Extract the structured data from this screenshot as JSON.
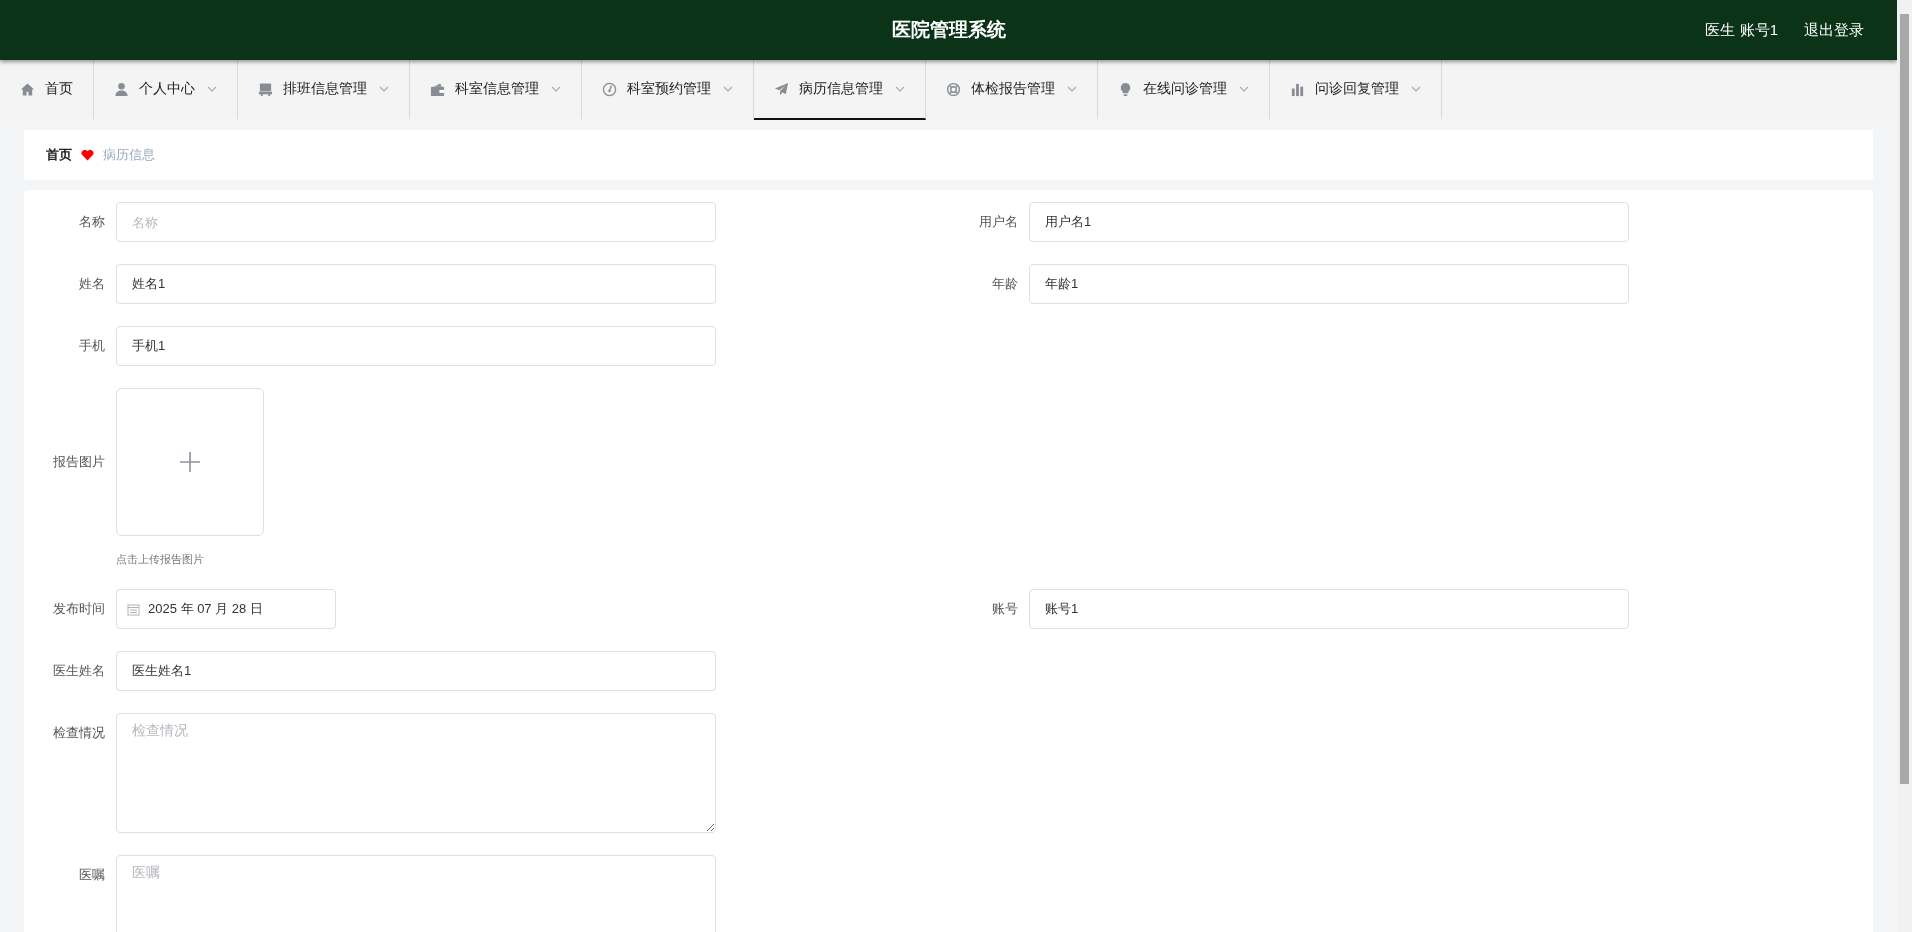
{
  "header": {
    "title": "医院管理系统",
    "user": "医生 账号1",
    "logout": "退出登录"
  },
  "nav": [
    {
      "label": "首页",
      "dropdown": false,
      "selected": false
    },
    {
      "label": "个人中心",
      "dropdown": true,
      "selected": false
    },
    {
      "label": "排班信息管理",
      "dropdown": true,
      "selected": false
    },
    {
      "label": "科室信息管理",
      "dropdown": true,
      "selected": false
    },
    {
      "label": "科室预约管理",
      "dropdown": true,
      "selected": false
    },
    {
      "label": "病历信息管理",
      "dropdown": true,
      "selected": true
    },
    {
      "label": "体检报告管理",
      "dropdown": true,
      "selected": false
    },
    {
      "label": "在线问诊管理",
      "dropdown": true,
      "selected": false
    },
    {
      "label": "问诊回复管理",
      "dropdown": true,
      "selected": false
    }
  ],
  "breadcrumb": [
    "首页",
    "病历信息"
  ],
  "form": [
    {
      "fields": [
        {
          "kind": "input",
          "label": "名称",
          "placeholder": "名称"
        },
        {
          "kind": "input",
          "label": "用户名",
          "value": "用户名1"
        }
      ]
    },
    {
      "fields": [
        {
          "kind": "input",
          "label": "姓名",
          "value": "姓名1"
        },
        {
          "kind": "input",
          "label": "年龄",
          "value": "年龄1"
        }
      ]
    },
    {
      "fields": [
        {
          "kind": "input",
          "label": "手机",
          "value": "手机1"
        }
      ]
    },
    {
      "fields": [
        {
          "kind": "upload",
          "label": "报告图片",
          "hint": "点击上传报告图片"
        }
      ]
    },
    {
      "fields": [
        {
          "kind": "date",
          "label": "发布时间",
          "value": "2025 年 07 月 28 日"
        },
        {
          "kind": "input",
          "label": "账号",
          "value": "账号1"
        }
      ]
    },
    {
      "fields": [
        {
          "kind": "input",
          "label": "医生姓名",
          "value": "医生姓名1"
        }
      ]
    },
    {
      "fields": [
        {
          "kind": "textarea",
          "label": "检查情况",
          "placeholder": "检查情况"
        }
      ]
    },
    {
      "fields": [
        {
          "kind": "textarea",
          "label": "医嘱",
          "placeholder": "医嘱"
        }
      ]
    }
  ]
}
